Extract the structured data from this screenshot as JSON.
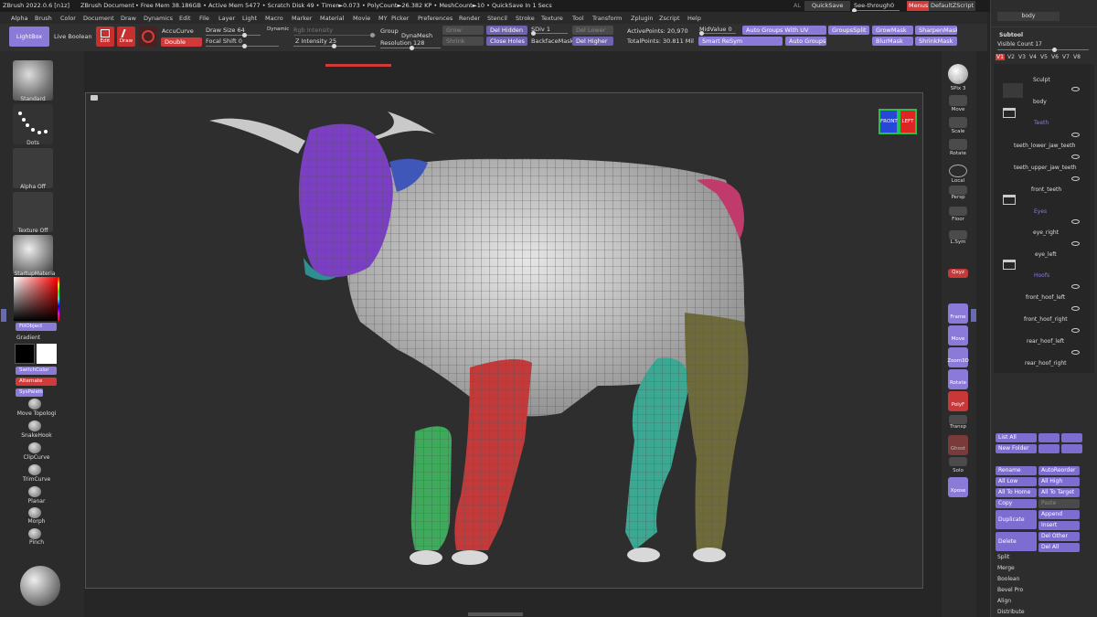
{
  "app": {
    "title": "ZBrush 2022.0.6 [n1z]",
    "document": "ZBrush Document",
    "stats": "• Free Mem 38.186GB • Active Mem 5477 • Scratch Disk 49 • Timer►0.073 • PolyCount►26.382 KP • MeshCount►10 • QuickSave In 1 Secs",
    "al": "AL",
    "quicksave": "QuickSave",
    "seethrough": "See-through",
    "seethrough_value": "0",
    "menus": "Menus",
    "defaultzscript": "DefaultZScript"
  },
  "menubar": [
    "Alpha",
    "Brush",
    "Color",
    "Document",
    "Draw",
    "Dynamics",
    "Edit",
    "File",
    "Layer",
    "Light",
    "Macro",
    "Marker",
    "Material",
    "Movie",
    "MY",
    "Picker",
    "Preferences",
    "Render",
    "Stencil",
    "Stroke",
    "Texture",
    "Tool",
    "Transform",
    "Zplugin",
    "Zscript",
    "Help"
  ],
  "toolbar": {
    "lightbox": "LightBox",
    "liveboolean": "Live Boolean",
    "edit": "Edit",
    "draw": "Draw",
    "accucurve": "AccuCurve",
    "double": "Double",
    "drawsize": "Draw Size 64",
    "dynamic": "Dynamic",
    "focalshift": "Focal Shift 0",
    "rgbintensity": "Rgb Intensity",
    "zintensity": "Z Intensity 25",
    "group": "Group",
    "dynamesh": "DynaMesh",
    "resolution": "Resolution 128",
    "grow": "Grow",
    "delhidden": "Del Hidden",
    "shrink": "Shrink",
    "closeholes": "Close Holes",
    "sdiv": "SDiv 1",
    "backfacemask": "BackfaceMask",
    "dellower": "Del Lower",
    "delhigher": "Del Higher",
    "activepoints": "ActivePoints: 20,970",
    "totalpoints": "TotalPoints: 30.811 Mil",
    "midvalue": "MidValue 0",
    "smartresym": "Smart ReSym",
    "autogroupsuv": "Auto Groups With UV",
    "autogroups": "Auto Groups",
    "groupsplit": "GroupsSplit",
    "growmask": "GrowMask",
    "blurmask": "BlurMask",
    "sharpenmask": "SharpenMask",
    "shrinkmask": "ShrinkMask"
  },
  "leftshelf": {
    "standard": "Standard",
    "dots": "Dots",
    "alphaoff": "Alpha Off",
    "textureoff": "Texture Off",
    "material": "StartupMateria",
    "fillobject": "FillObject",
    "gradient": "Gradient",
    "switchcolor": "SwitchColor",
    "alternate": "Alternate",
    "sysPalette": "SysPalette",
    "brushes": [
      "Move Topologi",
      "SnakeHook",
      "ClipCurve",
      "TrimCurve",
      "Planar",
      "Morph",
      "Pinch"
    ]
  },
  "rightshelf": [
    {
      "label": "BPR",
      "name": "bpr-icon"
    },
    {
      "label": "SPix 3",
      "name": "spix-icon"
    },
    {
      "label": "Move",
      "name": "move-icon"
    },
    {
      "label": "Scale",
      "name": "scale-icon"
    },
    {
      "label": "Rotate",
      "name": "rotate-icon"
    },
    {
      "label": "Local",
      "name": "local-icon"
    },
    {
      "label": "Persp",
      "name": "persp-icon"
    },
    {
      "label": "Floor",
      "name": "floor-icon"
    },
    {
      "label": "L.Sym",
      "name": "lsym-icon"
    },
    {
      "label": "Qxyz",
      "name": "qxyz-icon"
    },
    {
      "label": "Frame",
      "name": "frame-icon"
    },
    {
      "label": "Move",
      "name": "move2-icon"
    },
    {
      "label": "Zoom3D",
      "name": "zoom3d-icon"
    },
    {
      "label": "Rotate",
      "name": "rotate2-icon"
    },
    {
      "label": "PolyF",
      "name": "polyf-icon"
    },
    {
      "label": "Transp",
      "name": "transp-icon"
    },
    {
      "label": "Ghost",
      "name": "ghost-icon"
    },
    {
      "label": "Solo",
      "name": "solo-icon"
    },
    {
      "label": "Xpose",
      "name": "xpose-icon"
    }
  ],
  "gizmo": {
    "front": "FRONT",
    "left": "LEFT"
  },
  "subtool": {
    "body_top": "body",
    "header": "Subtool",
    "visible_count": "Visible Count 17",
    "versions": [
      "V1",
      "V2",
      "V3",
      "V4",
      "V5",
      "V6",
      "V7",
      "V8"
    ],
    "items": [
      {
        "name": "Sculpt",
        "type": "folder-label"
      },
      {
        "name": "body",
        "type": "item"
      },
      {
        "name": "Teeth",
        "type": "folder"
      },
      {
        "name": "teeth_lower_jaw_teeth",
        "type": "item"
      },
      {
        "name": "teeth_upper_jaw_teeth",
        "type": "item"
      },
      {
        "name": "front_teeth",
        "type": "item"
      },
      {
        "name": "Eyes",
        "type": "folder"
      },
      {
        "name": "eye_right",
        "type": "item"
      },
      {
        "name": "eye_left",
        "type": "item"
      },
      {
        "name": "Hoofs",
        "type": "folder"
      },
      {
        "name": "front_hoof_left",
        "type": "item"
      },
      {
        "name": "front_hoof_right",
        "type": "item"
      },
      {
        "name": "rear_hoof_left",
        "type": "item"
      },
      {
        "name": "rear_hoof_right",
        "type": "item"
      }
    ],
    "listall": "List All",
    "newfolder": "New Folder",
    "rename": "Rename",
    "autoreorder": "AutoReorder",
    "alllow": "All Low",
    "allhigh": "All High",
    "alltohome": "All To Home",
    "alltotarget": "All To Target",
    "copy": "Copy",
    "paste": "Paste",
    "duplicate": "Duplicate",
    "append": "Append",
    "insert": "Insert",
    "delete": "Delete",
    "delother": "Del Other",
    "delall": "Del All",
    "menu": [
      "Split",
      "Merge",
      "Boolean",
      "Bevel Pro",
      "Align",
      "Distribute"
    ]
  },
  "colors": {
    "accent": "#8c7ad8",
    "red": "#d23a3a",
    "head": "#7b3fc4",
    "leg_green": "#3daa5c",
    "leg_red": "#c23a3a",
    "leg_teal": "#3aa892",
    "leg_olive": "#6f6a3a"
  }
}
